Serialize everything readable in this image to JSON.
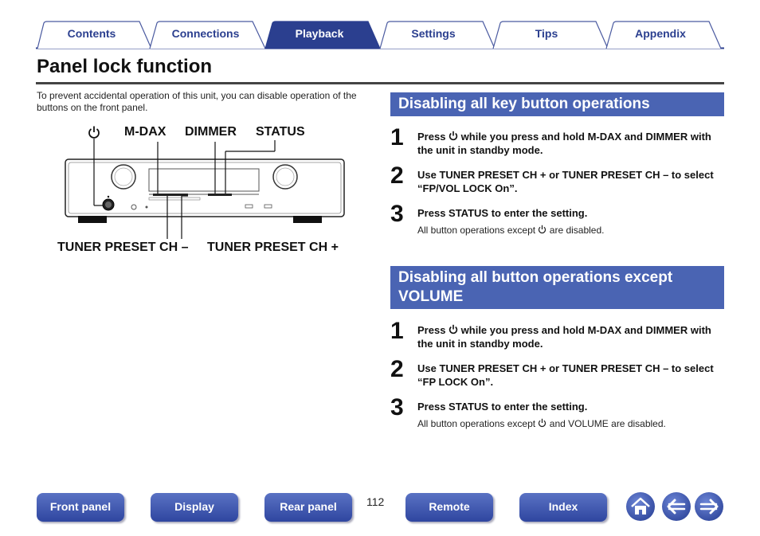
{
  "tabs": [
    {
      "label": "Contents",
      "active": false
    },
    {
      "label": "Connections",
      "active": false
    },
    {
      "label": "Playback",
      "active": true
    },
    {
      "label": "Settings",
      "active": false
    },
    {
      "label": "Tips",
      "active": false
    },
    {
      "label": "Appendix",
      "active": false
    }
  ],
  "page_title": "Panel lock function",
  "intro": "To prevent accidental operation of this unit, you can disable operation of the buttons on the front panel.",
  "diagram": {
    "label_mdax": "M-DAX",
    "label_dimmer": "DIMMER",
    "label_status": "STATUS",
    "label_preset_minus": "TUNER PRESET CH –",
    "label_preset_plus": "TUNER PRESET CH +"
  },
  "section1": {
    "heading": "Disabling all key button operations",
    "steps": [
      {
        "num": "1",
        "pre": "Press ",
        "post": " while you press and hold M-DAX and DIMMER with the unit in standby mode."
      },
      {
        "num": "2",
        "text": "Use TUNER PRESET CH + or TUNER PRESET CH – to select “FP/VOL LOCK On”."
      },
      {
        "num": "3",
        "text": "Press STATUS to enter the setting."
      }
    ],
    "note_pre": "All button operations except ",
    "note_post": " are disabled."
  },
  "section2": {
    "heading": "Disabling all button operations except VOLUME",
    "steps": [
      {
        "num": "1",
        "pre": "Press ",
        "post": " while you press and hold M-DAX and DIMMER with the unit in standby mode."
      },
      {
        "num": "2",
        "text": "Use TUNER PRESET CH + or TUNER PRESET CH – to select “FP LOCK On”."
      },
      {
        "num": "3",
        "text": "Press STATUS to enter the setting."
      }
    ],
    "note_pre": "All button operations except ",
    "note_post": " and VOLUME are disabled."
  },
  "bottom_nav": {
    "front_panel": "Front panel",
    "display": "Display",
    "rear_panel": "Rear panel",
    "remote": "Remote",
    "index": "Index",
    "page_number": "112"
  },
  "icons": {
    "home": "home-icon",
    "back": "arrow-left-icon",
    "forward": "arrow-right-icon",
    "power": "power-icon"
  },
  "colors": {
    "accent": "#4a64b3",
    "tab_text": "#2b3f8f",
    "tab_active": "#2b3f8f"
  }
}
